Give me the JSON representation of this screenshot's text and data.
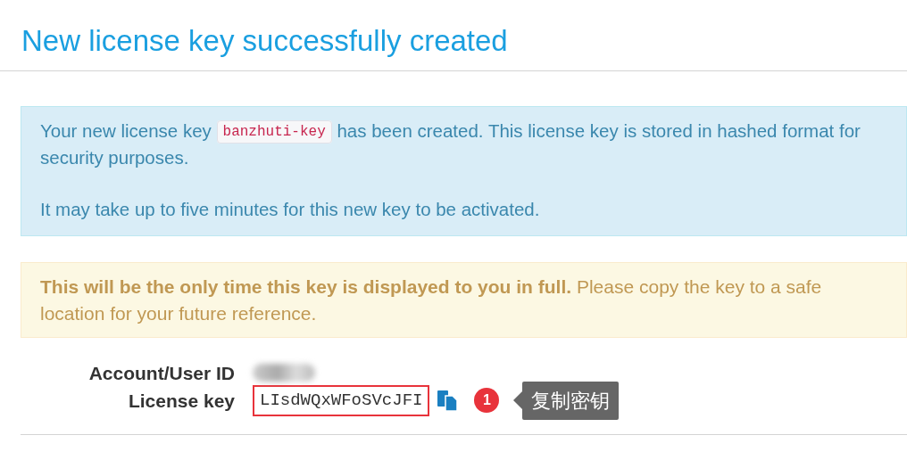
{
  "page": {
    "title": "New license key successfully created"
  },
  "info_alert": {
    "before": "Your new license key",
    "key_name": "banzhuti-key",
    "after": "has been created. This license key is stored in hashed format for security purposes.",
    "note": "It may take up to five minutes for this new key to be activated."
  },
  "warning_alert": {
    "text": "**This will be the only time this key is displayed to you in full.** Please copy the key to a safe location for your future reference."
  },
  "fields": [
    {
      "label": "Account/User ID",
      "redacted": true
    },
    {
      "label": "License key",
      "value": "LIsdWQxWFoSVcJFI",
      "highlighted": true
    }
  ],
  "annotation": {
    "number": "1",
    "text": "复制密钥"
  }
}
